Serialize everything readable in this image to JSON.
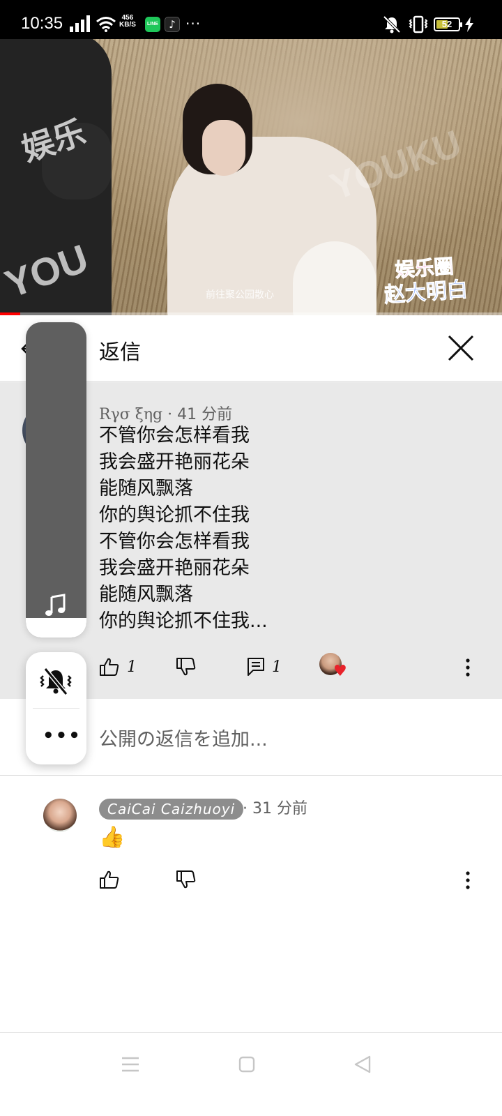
{
  "status_bar": {
    "time": "10:35",
    "net_speed_value": "456",
    "net_speed_unit": "KB/S",
    "line_app": "LINE",
    "more": "···",
    "battery_level": "52",
    "battery_fraction": 0.52
  },
  "video": {
    "watermark_cn": "娱乐",
    "watermark_you": "YOU",
    "watermark_right": "YOUKU",
    "subtitle": "前往聚公园散心",
    "logo_line1": "娱乐圈",
    "logo_line2": "赵大明白",
    "progress_fraction": 0.04,
    "progress_color": "#ff0000"
  },
  "panel": {
    "title": "返信"
  },
  "parent_comment": {
    "author": "Rγσ ξηg",
    "separator": " · ",
    "time": "41 分前",
    "lines": [
      "不管你会怎样看我",
      "我会盛开艳丽花朵",
      "能随风飘落",
      "你的舆论抓不住我",
      "不管你会怎样看我",
      "我会盛开艳丽花朵",
      "能随风飘落",
      "你的舆论抓不住我..."
    ],
    "like_count": "1",
    "reply_count": "1"
  },
  "add_reply": {
    "placeholder": "公開の返信を追加..."
  },
  "reply_comment": {
    "author": "CaiCai Caizhuoyi",
    "time": "· 31 分前",
    "text": "👍"
  },
  "icons": {
    "back": "arrow-left-icon",
    "close": "close-icon",
    "like": "thumbs-up-icon",
    "dislike": "thumbs-down-icon",
    "reply": "comment-icon",
    "creator_heart": "creator-heart-icon",
    "more": "more-vert-icon",
    "music": "music-note-icon",
    "mute": "bell-off-icon",
    "overflow": "more-horiz-icon"
  },
  "colors": {
    "accent_red": "#ff0000",
    "heart_red": "#e8222a",
    "highlight_bg": "#e9e9e9",
    "secondary_text": "#606060"
  }
}
